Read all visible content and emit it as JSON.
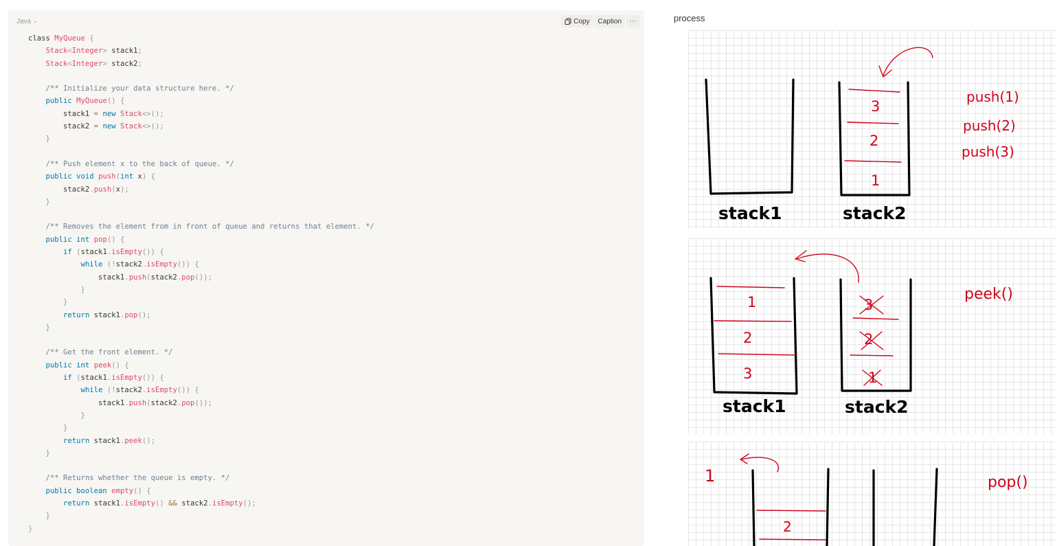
{
  "code_block": {
    "language": "Java",
    "copy_label": "Copy",
    "caption_label": "Caption",
    "more_label": "···",
    "lines": [
      [
        [
          "x",
          "class "
        ],
        [
          "t",
          "MyQueue"
        ],
        [
          "p",
          " {"
        ]
      ],
      [
        [
          "x",
          "    "
        ],
        [
          "t",
          "Stack"
        ],
        [
          "p",
          "<"
        ],
        [
          "t",
          "Integer"
        ],
        [
          "p",
          "> "
        ],
        [
          "x",
          "stack1"
        ],
        [
          "p",
          ";"
        ]
      ],
      [
        [
          "x",
          "    "
        ],
        [
          "t",
          "Stack"
        ],
        [
          "p",
          "<"
        ],
        [
          "t",
          "Integer"
        ],
        [
          "p",
          "> "
        ],
        [
          "x",
          "stack2"
        ],
        [
          "p",
          ";"
        ]
      ],
      [],
      [
        [
          "x",
          "    "
        ],
        [
          "c",
          "/** Initialize your data structure here. */"
        ]
      ],
      [
        [
          "x",
          "    "
        ],
        [
          "k",
          "public "
        ],
        [
          "f",
          "MyQueue"
        ],
        [
          "p",
          "() {"
        ]
      ],
      [
        [
          "x",
          "        stack1 "
        ],
        [
          "o",
          "="
        ],
        [
          "x",
          " "
        ],
        [
          "k",
          "new "
        ],
        [
          "t",
          "Stack"
        ],
        [
          "p",
          "<>();"
        ]
      ],
      [
        [
          "x",
          "        stack2 "
        ],
        [
          "o",
          "="
        ],
        [
          "x",
          " "
        ],
        [
          "k",
          "new "
        ],
        [
          "t",
          "Stack"
        ],
        [
          "p",
          "<>();"
        ]
      ],
      [
        [
          "x",
          "    "
        ],
        [
          "p",
          "}"
        ]
      ],
      [],
      [
        [
          "x",
          "    "
        ],
        [
          "c",
          "/** Push element x to the back of queue. */"
        ]
      ],
      [
        [
          "x",
          "    "
        ],
        [
          "k",
          "public void "
        ],
        [
          "f",
          "push"
        ],
        [
          "p",
          "("
        ],
        [
          "k",
          "int "
        ],
        [
          "x",
          "x"
        ],
        [
          "p",
          ") {"
        ]
      ],
      [
        [
          "x",
          "        stack2"
        ],
        [
          "p",
          "."
        ],
        [
          "f",
          "push"
        ],
        [
          "p",
          "("
        ],
        [
          "x",
          "x"
        ],
        [
          "p",
          ");"
        ]
      ],
      [
        [
          "x",
          "    "
        ],
        [
          "p",
          "}"
        ]
      ],
      [],
      [
        [
          "x",
          "    "
        ],
        [
          "c",
          "/** Removes the element from in front of queue and returns that element. */"
        ]
      ],
      [
        [
          "x",
          "    "
        ],
        [
          "k",
          "public int "
        ],
        [
          "f",
          "pop"
        ],
        [
          "p",
          "() {"
        ]
      ],
      [
        [
          "x",
          "        "
        ],
        [
          "k",
          "if "
        ],
        [
          "p",
          "("
        ],
        [
          "x",
          "stack1"
        ],
        [
          "p",
          "."
        ],
        [
          "f",
          "isEmpty"
        ],
        [
          "p",
          "()) {"
        ]
      ],
      [
        [
          "x",
          "            "
        ],
        [
          "k",
          "while "
        ],
        [
          "p",
          "(!"
        ],
        [
          "x",
          "stack2"
        ],
        [
          "p",
          "."
        ],
        [
          "f",
          "isEmpty"
        ],
        [
          "p",
          "()) {"
        ]
      ],
      [
        [
          "x",
          "                stack1"
        ],
        [
          "p",
          "."
        ],
        [
          "f",
          "push"
        ],
        [
          "p",
          "("
        ],
        [
          "x",
          "stack2"
        ],
        [
          "p",
          "."
        ],
        [
          "f",
          "pop"
        ],
        [
          "p",
          "());"
        ]
      ],
      [
        [
          "x",
          "            "
        ],
        [
          "p",
          "}"
        ]
      ],
      [
        [
          "x",
          "        "
        ],
        [
          "p",
          "}"
        ]
      ],
      [
        [
          "x",
          "        "
        ],
        [
          "k",
          "return "
        ],
        [
          "x",
          "stack1"
        ],
        [
          "p",
          "."
        ],
        [
          "f",
          "pop"
        ],
        [
          "p",
          "();"
        ]
      ],
      [
        [
          "x",
          "    "
        ],
        [
          "p",
          "}"
        ]
      ],
      [],
      [
        [
          "x",
          "    "
        ],
        [
          "c",
          "/** Get the front element. */"
        ]
      ],
      [
        [
          "x",
          "    "
        ],
        [
          "k",
          "public int "
        ],
        [
          "f",
          "peek"
        ],
        [
          "p",
          "() {"
        ]
      ],
      [
        [
          "x",
          "        "
        ],
        [
          "k",
          "if "
        ],
        [
          "p",
          "("
        ],
        [
          "x",
          "stack1"
        ],
        [
          "p",
          "."
        ],
        [
          "f",
          "isEmpty"
        ],
        [
          "p",
          "()) {"
        ]
      ],
      [
        [
          "x",
          "            "
        ],
        [
          "k",
          "while "
        ],
        [
          "p",
          "(!"
        ],
        [
          "x",
          "stack2"
        ],
        [
          "p",
          "."
        ],
        [
          "f",
          "isEmpty"
        ],
        [
          "p",
          "()) {"
        ]
      ],
      [
        [
          "x",
          "                stack1"
        ],
        [
          "p",
          "."
        ],
        [
          "f",
          "push"
        ],
        [
          "p",
          "("
        ],
        [
          "x",
          "stack2"
        ],
        [
          "p",
          "."
        ],
        [
          "f",
          "pop"
        ],
        [
          "p",
          "());"
        ]
      ],
      [
        [
          "x",
          "            "
        ],
        [
          "p",
          "}"
        ]
      ],
      [
        [
          "x",
          "        "
        ],
        [
          "p",
          "}"
        ]
      ],
      [
        [
          "x",
          "        "
        ],
        [
          "k",
          "return "
        ],
        [
          "x",
          "stack1"
        ],
        [
          "p",
          "."
        ],
        [
          "f",
          "peek"
        ],
        [
          "p",
          "();"
        ]
      ],
      [
        [
          "x",
          "    "
        ],
        [
          "p",
          "}"
        ]
      ],
      [],
      [
        [
          "x",
          "    "
        ],
        [
          "c",
          "/** Returns whether the queue is empty. */"
        ]
      ],
      [
        [
          "x",
          "    "
        ],
        [
          "k",
          "public boolean "
        ],
        [
          "f",
          "empty"
        ],
        [
          "p",
          "() {"
        ]
      ],
      [
        [
          "x",
          "        "
        ],
        [
          "k",
          "return "
        ],
        [
          "x",
          "stack1"
        ],
        [
          "p",
          "."
        ],
        [
          "f",
          "isEmpty"
        ],
        [
          "p",
          "() "
        ],
        [
          "o",
          "&&"
        ],
        [
          "x",
          " stack2"
        ],
        [
          "p",
          "."
        ],
        [
          "f",
          "isEmpty"
        ],
        [
          "p",
          "();"
        ]
      ],
      [
        [
          "x",
          "    "
        ],
        [
          "p",
          "}"
        ]
      ],
      [
        [
          "p",
          "}"
        ]
      ]
    ]
  },
  "process": {
    "label": "process",
    "sketch1": {
      "stack1_label": "stack1",
      "stack2_label": "stack2",
      "stack2_items": [
        "3",
        "2",
        "1"
      ],
      "ops": [
        "push(1)",
        "push(2)",
        "push(3)"
      ]
    },
    "sketch2": {
      "stack1_label": "stack1",
      "stack2_label": "stack2",
      "stack1_items": [
        "1",
        "2",
        "3"
      ],
      "stack2_items": [
        "3",
        "2",
        "1"
      ],
      "op": "peek()"
    },
    "sketch3": {
      "stack1_items": [
        "2"
      ],
      "popped": "1",
      "op": "pop()"
    }
  }
}
